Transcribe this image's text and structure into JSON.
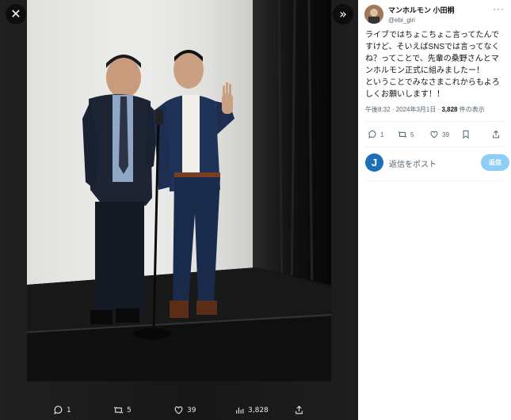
{
  "controls": {
    "close_glyph": "✕",
    "next_glyph": "»"
  },
  "post": {
    "author_name": "マンホルモン 小田桐",
    "author_handle": "@ebi_giri",
    "more_glyph": "···",
    "text": "ライブではちょこちょこ言ってたんですけど、そいえばSNSでは言ってなくね？ってことで、先輩の桑野さんとマンホルモン正式に組みましたー！\nということでみなさまこれからもよろしくお願いします！！",
    "time": "午後8:32 · 2024年3月1日 · ",
    "views_count": "3,828",
    "views_label": " 件の表示"
  },
  "actions": {
    "replies": "1",
    "reposts": "5",
    "likes": "39"
  },
  "media_actions": {
    "replies": "1",
    "reposts": "5",
    "likes": "39",
    "views": "3,828"
  },
  "reply_box": {
    "avatar_letter": "J",
    "placeholder": "返信をポスト",
    "button_label": "返信"
  },
  "colors": {
    "accent_button": "#8ecdf8",
    "backdrop": "#1c1c1c",
    "panel": "#ffffff"
  }
}
